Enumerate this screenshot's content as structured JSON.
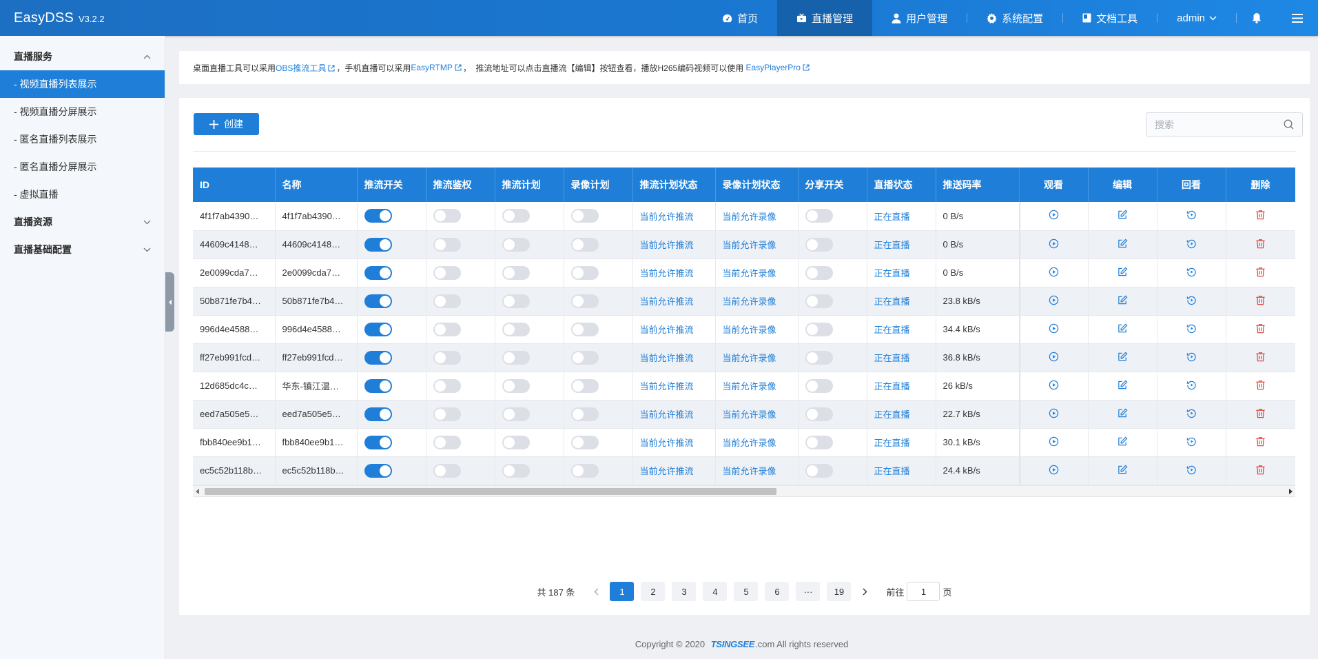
{
  "brand": {
    "name": "EasyDSS",
    "version": "V3.2.2"
  },
  "nav": {
    "home": "首页",
    "live": "直播管理",
    "users": "用户管理",
    "system": "系统配置",
    "docs": "文档工具",
    "user": "admin"
  },
  "sidebar": {
    "group1": "直播服务",
    "items": [
      "- 视频直播列表展示",
      "- 视频直播分屏展示",
      "- 匿名直播列表展示",
      "- 匿名直播分屏展示",
      "- 虚拟直播"
    ],
    "group2": "直播资源",
    "group3": "直播基础配置"
  },
  "notice": {
    "t1": "桌面直播工具可以采用 ",
    "l1": "OBS推流工具",
    "t2": "，手机直播可以采用 ",
    "l2": "EasyRTMP",
    "t3": "，  推流地址可以点击直播流【编辑】按钮查看，播放H265编码视频可以使用 ",
    "l3": "EasyPlayerPro"
  },
  "toolbar": {
    "create": "创建",
    "search_placeholder": "搜索"
  },
  "table": {
    "headers": [
      "ID",
      "名称",
      "推流开关",
      "推流鉴权",
      "推流计划",
      "录像计划",
      "推流计划状态",
      "录像计划状态",
      "分享开关",
      "直播状态",
      "推送码率",
      "观看",
      "编辑",
      "回看",
      "删除"
    ],
    "rows": [
      {
        "id": "4f1f7ab4390…",
        "name": "4f1f7ab4390…",
        "push": true,
        "plan_status": "当前允许推流",
        "rec_status": "当前允许录像",
        "live": "正在直播",
        "rate": "0 B/s"
      },
      {
        "id": "44609c4148…",
        "name": "44609c4148…",
        "push": true,
        "plan_status": "当前允许推流",
        "rec_status": "当前允许录像",
        "live": "正在直播",
        "rate": "0 B/s"
      },
      {
        "id": "2e0099cda7…",
        "name": "2e0099cda7…",
        "push": true,
        "plan_status": "当前允许推流",
        "rec_status": "当前允许录像",
        "live": "正在直播",
        "rate": "0 B/s"
      },
      {
        "id": "50b871fe7b4…",
        "name": "50b871fe7b4…",
        "push": true,
        "plan_status": "当前允许推流",
        "rec_status": "当前允许录像",
        "live": "正在直播",
        "rate": "23.8 kB/s"
      },
      {
        "id": "996d4e4588…",
        "name": "996d4e4588…",
        "push": true,
        "plan_status": "当前允许推流",
        "rec_status": "当前允许录像",
        "live": "正在直播",
        "rate": "34.4 kB/s"
      },
      {
        "id": "ff27eb991fcd…",
        "name": "ff27eb991fcd…",
        "push": true,
        "plan_status": "当前允许推流",
        "rec_status": "当前允许录像",
        "live": "正在直播",
        "rate": "36.8 kB/s"
      },
      {
        "id": "12d685dc4c…",
        "name": "华东-镇江温…",
        "push": true,
        "plan_status": "当前允许推流",
        "rec_status": "当前允许录像",
        "live": "正在直播",
        "rate": "26 kB/s"
      },
      {
        "id": "eed7a505e5…",
        "name": "eed7a505e5…",
        "push": true,
        "plan_status": "当前允许推流",
        "rec_status": "当前允许录像",
        "live": "正在直播",
        "rate": "22.7 kB/s"
      },
      {
        "id": "fbb840ee9b1…",
        "name": "fbb840ee9b1…",
        "push": true,
        "plan_status": "当前允许推流",
        "rec_status": "当前允许录像",
        "live": "正在直播",
        "rate": "30.1 kB/s"
      },
      {
        "id": "ec5c52b118b…",
        "name": "ec5c52b118b…",
        "push": true,
        "plan_status": "当前允许推流",
        "rec_status": "当前允许录像",
        "live": "正在直播",
        "rate": "24.4 kB/s"
      }
    ]
  },
  "pagination": {
    "total": "共 187 条",
    "pages": [
      "1",
      "2",
      "3",
      "4",
      "5",
      "6",
      "···",
      "19"
    ],
    "current": "1",
    "goto_prefix": "前往",
    "goto_value": "1",
    "goto_suffix": "页"
  },
  "footer": {
    "prefix": "Copyright © 2020 ",
    "logo": "TSINGSEE",
    "suffix": ".com All rights reserved"
  },
  "colors": {
    "primary": "#1f7fd8",
    "danger": "#e0473d",
    "header_bg": "#1a73c8"
  }
}
